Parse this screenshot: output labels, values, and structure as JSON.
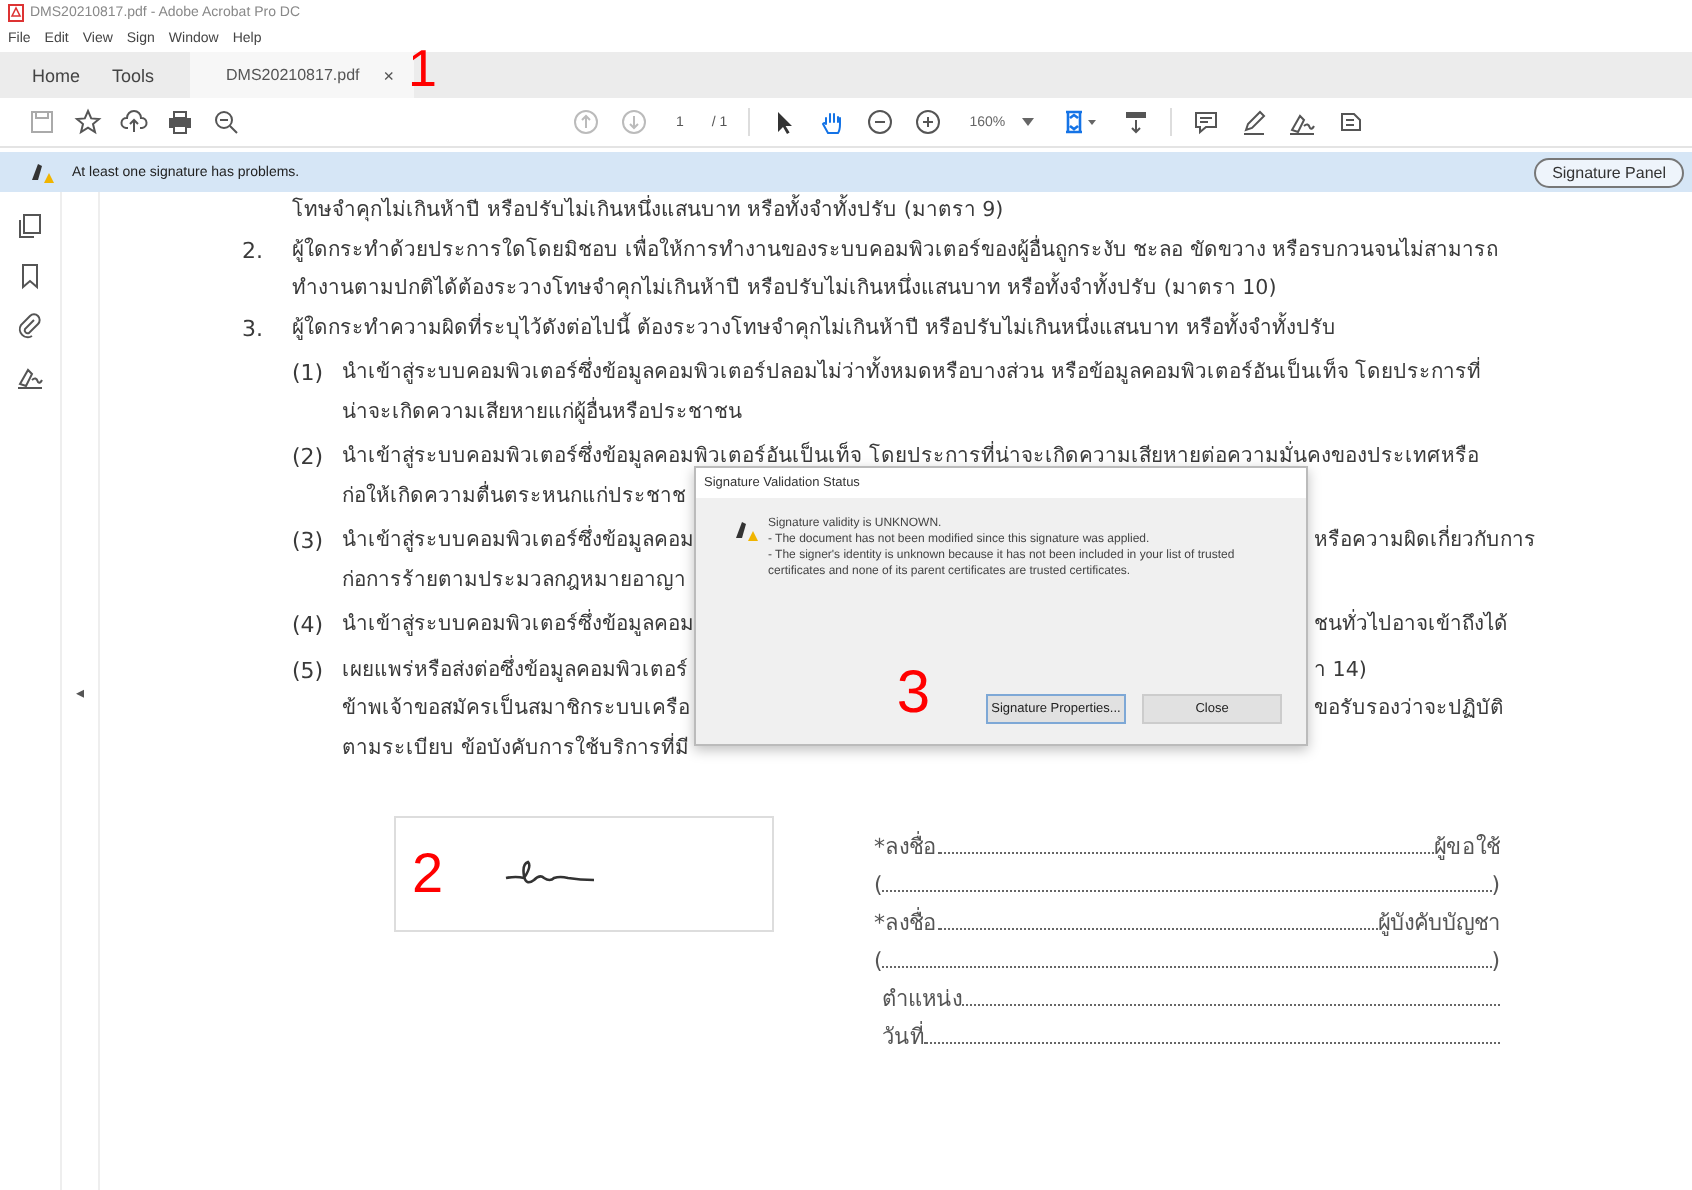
{
  "window": {
    "title": "DMS20210817.pdf - Adobe Acrobat Pro DC"
  },
  "menu": [
    "File",
    "Edit",
    "View",
    "Sign",
    "Window",
    "Help"
  ],
  "tabs": [
    {
      "label": "Home",
      "selected": false
    },
    {
      "label": "Tools",
      "selected": false
    },
    {
      "label": "DMS20210817.pdf",
      "selected": true,
      "close": "×"
    }
  ],
  "tab_annotation": "1",
  "toolbar": {
    "page": "1",
    "page_total": "/ 1",
    "zoom": "160%"
  },
  "notification": {
    "message": "At least one signature has problems.",
    "button": "Signature Panel"
  },
  "collapse_arrow": "◂",
  "document": {
    "lines": [
      {
        "kind": "cont",
        "text": "โทษจำคุกไม่เกินห้าปี หรือปรับไม่เกินหนึ่งแสนบาท หรือทั้งจำทั้งปรับ (มาตรา 9)"
      },
      {
        "kind": "num",
        "marker": "2.",
        "text": "ผู้ใดกระทำด้วยประการใดโดยมิชอบ เพื่อให้การทำงานของระบบคอมพิวเตอร์ของผู้อื่นถูกระงับ ชะลอ ขัดขวาง หรือรบกวนจนไม่สามารถ"
      },
      {
        "kind": "cont",
        "text": "ทำงานตามปกติได้ต้องระวางโทษจำคุกไม่เกินห้าปี หรือปรับไม่เกินหนึ่งแสนบาท หรือทั้งจำทั้งปรับ (มาตรา 10)"
      },
      {
        "kind": "num",
        "marker": "3.",
        "text": "ผู้ใดกระทำความผิดที่ระบุไว้ดังต่อไปนี้ ต้องระวางโทษจำคุกไม่เกินห้าปี หรือปรับไม่เกินหนึ่งแสนบาท หรือทั้งจำทั้งปรับ"
      },
      {
        "kind": "sub",
        "marker": "(1)",
        "text": "นำเข้าสู่ระบบคอมพิวเตอร์ซึ่งข้อมูลคอมพิวเตอร์ปลอมไม่ว่าทั้งหมดหรือบางส่วน หรือข้อมูลคอมพิวเตอร์อันเป็นเท็จ โดยประการที่"
      },
      {
        "kind": "subcont",
        "text": "น่าจะเกิดความเสียหายแก่ผู้อื่นหรือประชาชน"
      },
      {
        "kind": "sub",
        "marker": "(2)",
        "text": "นำเข้าสู่ระบบคอมพิวเตอร์ซึ่งข้อมูลคอมพิวเตอร์อันเป็นเท็จ โดยประการที่น่าจะเกิดความเสียหายต่อความมั่นคงของประเทศหรือ"
      },
      {
        "kind": "subcont",
        "text": "ก่อให้เกิดความตื่นตระหนกแก่ประชาช"
      },
      {
        "kind": "sub",
        "marker": "(3)",
        "text": "นำเข้าสู่ระบบคอมพิวเตอร์ซึ่งข้อมูลคอม",
        "right": "หรือความผิดเกี่ยวกับการ"
      },
      {
        "kind": "subcont",
        "text": "ก่อการร้ายตามประมวลกฎหมายอาญา"
      },
      {
        "kind": "sub",
        "marker": "(4)",
        "text": "นำเข้าสู่ระบบคอมพิวเตอร์ซึ่งข้อมูลคอม",
        "right": "ชนทั่วไปอาจเข้าถึงได้"
      },
      {
        "kind": "sub",
        "marker": "(5)",
        "text": "เผยแพร่หรือส่งต่อซึ่งข้อมูลคอมพิวเตอร์",
        "right": "า 14)"
      },
      {
        "kind": "subcont",
        "text": "ข้าพเจ้าขอสมัครเป็นสมาชิกระบบเครือ",
        "right": "ขอรับรองว่าจะปฏิบัติ"
      },
      {
        "kind": "subcont",
        "text": "ตามระเบียบ ข้อบังคับการใช้บริการที่มี"
      }
    ],
    "signature_annotation": "2",
    "form": [
      {
        "kind": "sign",
        "label": "*ลงชื่อ",
        "tail": "ผู้ขอใช้"
      },
      {
        "kind": "paren",
        "open": "(",
        "close": ")"
      },
      {
        "kind": "sign",
        "label": "*ลงชื่อ",
        "tail": "ผู้บังคับบัญชา"
      },
      {
        "kind": "paren",
        "open": "(",
        "close": ")"
      },
      {
        "kind": "field",
        "label": "ตำแหน่ง"
      },
      {
        "kind": "field",
        "label": "วันที่"
      }
    ]
  },
  "dialog": {
    "title": "Signature Validation Status",
    "heading": "Signature validity is UNKNOWN.",
    "details": [
      "- The document has not been modified since this signature was applied.",
      "- The signer's identity is unknown because it has not been included in your list of trusted certificates and none of its parent certificates are trusted certificates."
    ],
    "annotation": "3",
    "buttons": [
      {
        "label": "Signature Properties...",
        "selected": true
      },
      {
        "label": "Close",
        "selected": false
      }
    ]
  }
}
